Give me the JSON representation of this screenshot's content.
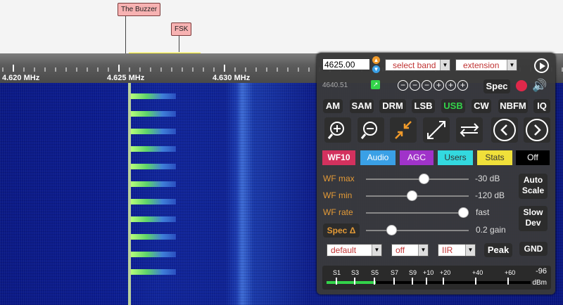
{
  "markers": {
    "buzzer": "The Buzzer",
    "fsk": "FSK"
  },
  "scale": {
    "ticks": [
      "4.620 MHz",
      "4.625 MHz",
      "4.630 MHz"
    ]
  },
  "control": {
    "freq_value": "4625.00",
    "band_select": "select band",
    "extension_select": "extension",
    "sub_freq": "4640.51",
    "spec_button": "Spec",
    "zoom_buttons": [
      "−",
      "−",
      "−",
      "+",
      "+",
      "+"
    ],
    "modes": [
      "AM",
      "SAM",
      "DRM",
      "LSB",
      "USB",
      "CW",
      "NBFM",
      "IQ"
    ],
    "active_mode": "USB",
    "categories": [
      {
        "label": "WF10",
        "color": "#d3315e",
        "text": "#ffffff"
      },
      {
        "label": "Audio",
        "color": "#3aa0e6",
        "text": "#ffffff"
      },
      {
        "label": "AGC",
        "color": "#a033c9",
        "text": "#ffffff"
      },
      {
        "label": "Users",
        "color": "#33d9df",
        "text": "#333333"
      },
      {
        "label": "Stats",
        "color": "#f0e03a",
        "text": "#333333"
      },
      {
        "label": "Off",
        "color": "#000000",
        "text": "#ffffff"
      }
    ],
    "sliders": [
      {
        "label": "WF max",
        "value": "-30 dB",
        "level": 0.57
      },
      {
        "label": "WF min",
        "value": "-120 dB",
        "level": 0.44
      },
      {
        "label": "WF rate",
        "value": "fast",
        "level": 1.0
      },
      {
        "label": "Spec Δ",
        "value": "0.2 gain",
        "level": 0.22
      }
    ],
    "side_buttons": {
      "auto_scale": [
        "Auto",
        "Scale"
      ],
      "slow_dev": [
        "Slow",
        "Dev"
      ],
      "gnd": "GND"
    },
    "bottom_selects": {
      "palette": "default",
      "aperture": "off",
      "filter": "IIR"
    },
    "peak_button": "Peak",
    "smeter": {
      "ticks": [
        "S1",
        "S3",
        "S5",
        "S7",
        "S9",
        "+10",
        "+20",
        "+40",
        "+60"
      ],
      "reading": "-96",
      "unit": "dBm",
      "level": 0.24
    },
    "accent": "#33d34a"
  }
}
